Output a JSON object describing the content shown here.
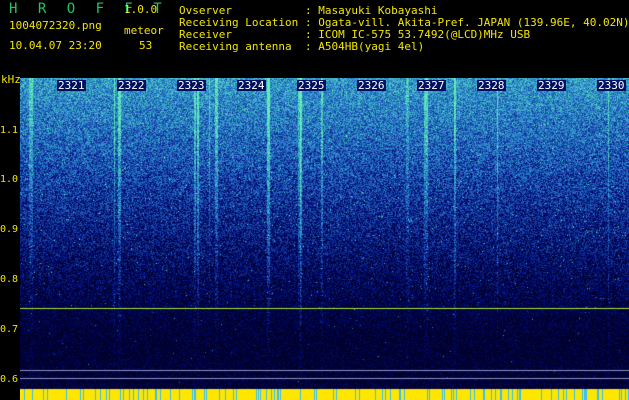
{
  "header": {
    "title": "H R O F F T",
    "version": "1.0.0",
    "filename": "1004072320.png",
    "meteor_label": "meteor",
    "datetime": "10.04.07 23:20",
    "meteor_count": "53"
  },
  "info": [
    {
      "key": "Ovserver",
      "value": ": Masayuki Kobayashi"
    },
    {
      "key": "Receiving Location",
      "value": ": Ogata-vill. Akita-Pref. JAPAN (139.96E, 40.02N)"
    },
    {
      "key": "Receiver",
      "value": ": ICOM IC-575 53.7492(@LCD)MHz USB"
    },
    {
      "key": "Receiving antenna",
      "value": ": A504HB(yagi 4el)"
    }
  ],
  "axis": {
    "unit": "kHz",
    "y_ticks": [
      "1.1",
      "1.0",
      "0.9",
      "0.8",
      "0.7",
      "0.6"
    ],
    "time_ticks": [
      "2321",
      "2322",
      "2323",
      "2324",
      "2325",
      "2326",
      "2327",
      "2328",
      "2329",
      "2330"
    ]
  },
  "colors": {
    "label_green": "#22c55e",
    "label_yellow": "#f2e600",
    "background": "#000000",
    "spectrum_dark": "#000a30",
    "spectrum_mid": "#1a4dc8",
    "spectrum_bright": "#37d9c8",
    "carrier_line": "#a6e22e",
    "marker_strip": "#ffe600"
  }
}
